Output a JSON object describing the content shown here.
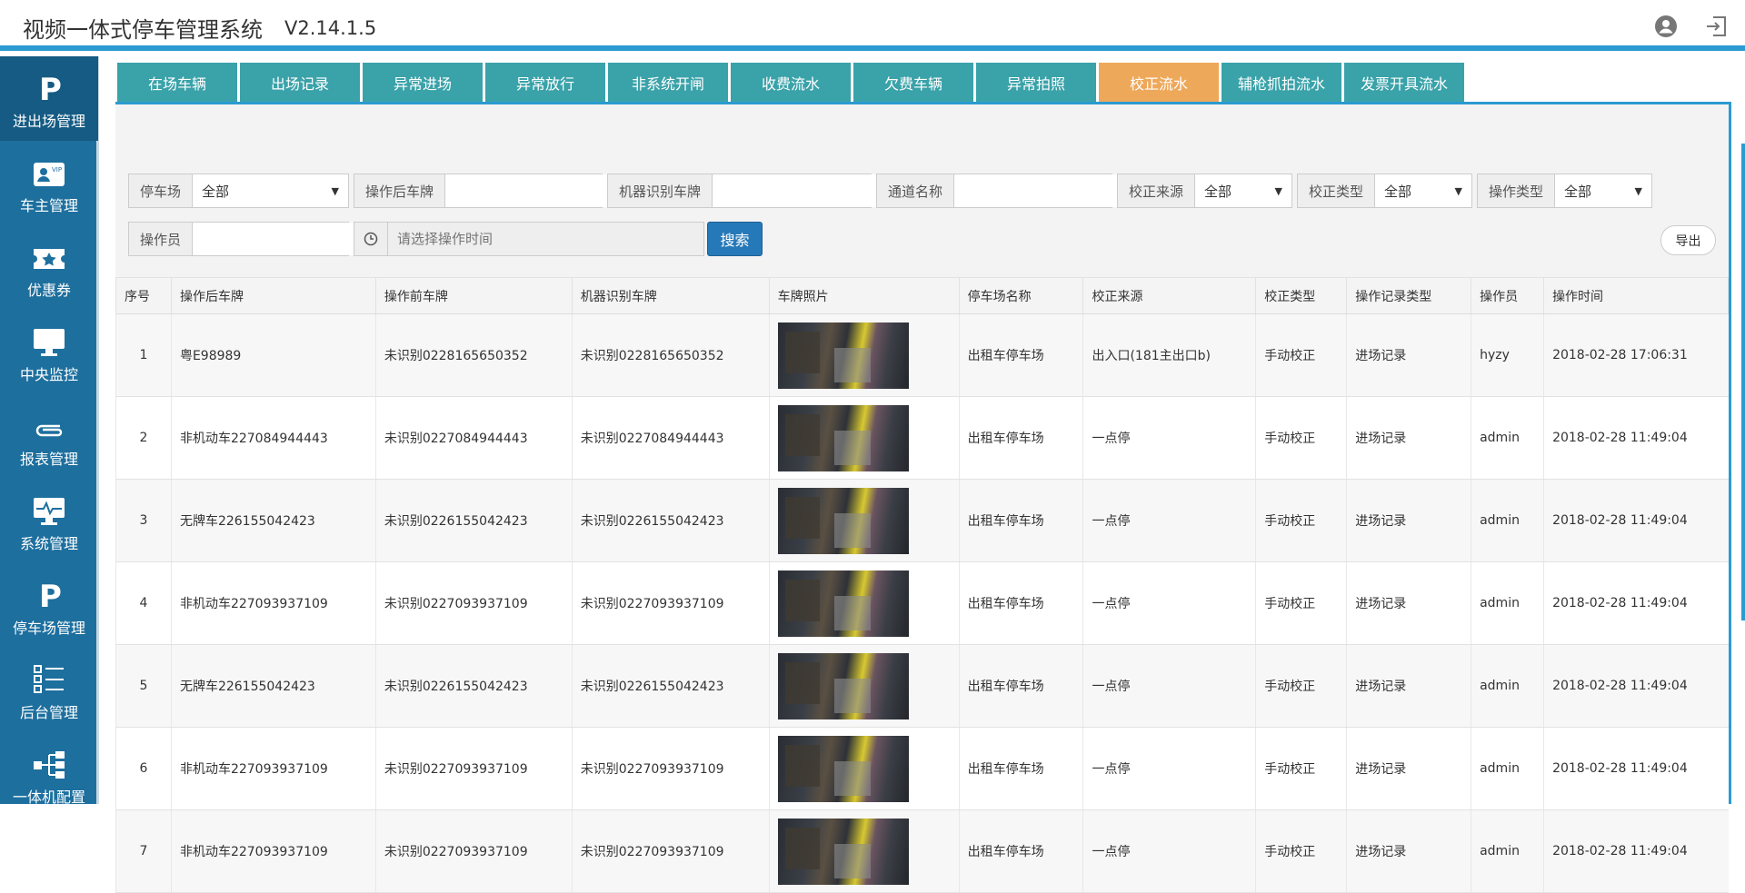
{
  "header": {
    "title": "视频一体式停车管理系统",
    "version": "V2.14.1.5",
    "user_icon": "user-circle-icon",
    "logout_icon": "logout-icon"
  },
  "sidebar": {
    "items": [
      {
        "label": "进出场管理",
        "icon": "parking-p-icon",
        "active": true
      },
      {
        "label": "车主管理",
        "icon": "vip-card-icon"
      },
      {
        "label": "优惠券",
        "icon": "coupon-star-icon"
      },
      {
        "label": "中央监控",
        "icon": "monitor-icon"
      },
      {
        "label": "报表管理",
        "icon": "paperclip-icon"
      },
      {
        "label": "系统管理",
        "icon": "monitor-pulse-icon"
      },
      {
        "label": "停车场管理",
        "icon": "parking-p-icon"
      },
      {
        "label": "后台管理",
        "icon": "list-icon"
      },
      {
        "label": "一体机配置",
        "icon": "network-tree-icon"
      }
    ]
  },
  "tabs": [
    {
      "label": "在场车辆"
    },
    {
      "label": "出场记录"
    },
    {
      "label": "异常进场"
    },
    {
      "label": "异常放行"
    },
    {
      "label": "非系统开闸"
    },
    {
      "label": "收费流水"
    },
    {
      "label": "欠费车辆"
    },
    {
      "label": "异常拍照"
    },
    {
      "label": "校正流水",
      "active": true
    },
    {
      "label": "辅枪抓拍流水"
    },
    {
      "label": "发票开具流水"
    }
  ],
  "filters": {
    "parking_lot": {
      "label": "停车场",
      "value": "全部"
    },
    "plate_after": {
      "label": "操作后车牌",
      "value": ""
    },
    "plate_machine": {
      "label": "机器识别车牌",
      "value": ""
    },
    "channel_name": {
      "label": "通道名称",
      "value": ""
    },
    "correction_source": {
      "label": "校正来源",
      "value": "全部"
    },
    "correction_type": {
      "label": "校正类型",
      "value": "全部"
    },
    "operation_type": {
      "label": "操作类型",
      "value": "全部"
    },
    "operator": {
      "label": "操作员",
      "value": ""
    },
    "operation_time": {
      "placeholder": "请选择操作时间",
      "icon": "clock-icon"
    },
    "search_label": "搜索",
    "export_label": "导出"
  },
  "table": {
    "columns": [
      "序号",
      "操作后车牌",
      "操作前车牌",
      "机器识别车牌",
      "车牌照片",
      "停车场名称",
      "校正来源",
      "校正类型",
      "操作记录类型",
      "操作员",
      "操作时间"
    ],
    "rows": [
      {
        "no": "1",
        "after": "粤E98989",
        "before": "未识别0228165650352",
        "machine": "未识别0228165650352",
        "lot": "出租车停车场",
        "source": "出入口(181主出口b)",
        "ctype": "手动校正",
        "rtype": "进场记录",
        "operator": "hyzy",
        "time": "2018-02-28 17:06:31"
      },
      {
        "no": "2",
        "after": "非机动车227084944443",
        "before": "未识别0227084944443",
        "machine": "未识别0227084944443",
        "lot": "出租车停车场",
        "source": "一点停",
        "ctype": "手动校正",
        "rtype": "进场记录",
        "operator": "admin",
        "time": "2018-02-28 11:49:04"
      },
      {
        "no": "3",
        "after": "无牌车226155042423",
        "before": "未识别0226155042423",
        "machine": "未识别0226155042423",
        "lot": "出租车停车场",
        "source": "一点停",
        "ctype": "手动校正",
        "rtype": "进场记录",
        "operator": "admin",
        "time": "2018-02-28 11:49:04"
      },
      {
        "no": "4",
        "after": "非机动车227093937109",
        "before": "未识别0227093937109",
        "machine": "未识别0227093937109",
        "lot": "出租车停车场",
        "source": "一点停",
        "ctype": "手动校正",
        "rtype": "进场记录",
        "operator": "admin",
        "time": "2018-02-28 11:49:04"
      },
      {
        "no": "5",
        "after": "无牌车226155042423",
        "before": "未识别0226155042423",
        "machine": "未识别0226155042423",
        "lot": "出租车停车场",
        "source": "一点停",
        "ctype": "手动校正",
        "rtype": "进场记录",
        "operator": "admin",
        "time": "2018-02-28 11:49:04"
      },
      {
        "no": "6",
        "after": "非机动车227093937109",
        "before": "未识别0227093937109",
        "machine": "未识别0227093937109",
        "lot": "出租车停车场",
        "source": "一点停",
        "ctype": "手动校正",
        "rtype": "进场记录",
        "operator": "admin",
        "time": "2018-02-28 11:49:04"
      },
      {
        "no": "7",
        "after": "非机动车227093937109",
        "before": "未识别0227093937109",
        "machine": "未识别0227093937109",
        "lot": "出租车停车场",
        "source": "一点停",
        "ctype": "手动校正",
        "rtype": "进场记录",
        "operator": "admin",
        "time": "2018-02-28 11:49:04"
      }
    ]
  },
  "colors": {
    "accent": "#2b9bd1",
    "sidebar": "#1d6f9e",
    "tab": "#3aa2a9",
    "tab_active": "#eea85a",
    "search_button": "#2679b9"
  }
}
